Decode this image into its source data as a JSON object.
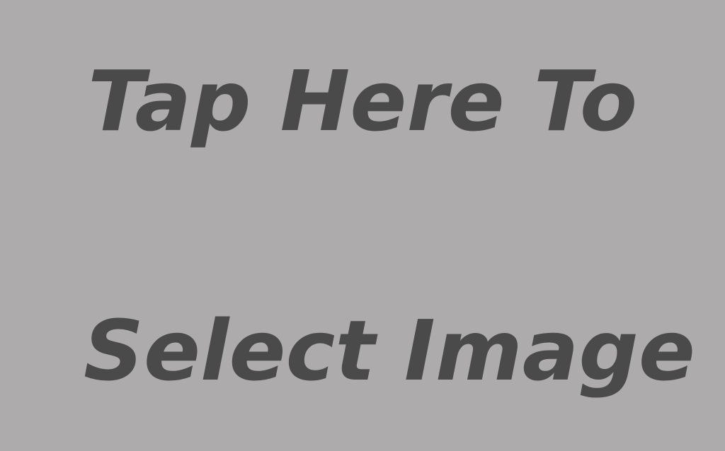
{
  "placeholder": {
    "line1": "Tap Here To",
    "line2": "Select Image"
  },
  "colors": {
    "background": "#adabac",
    "text": "#4a4a4a"
  }
}
